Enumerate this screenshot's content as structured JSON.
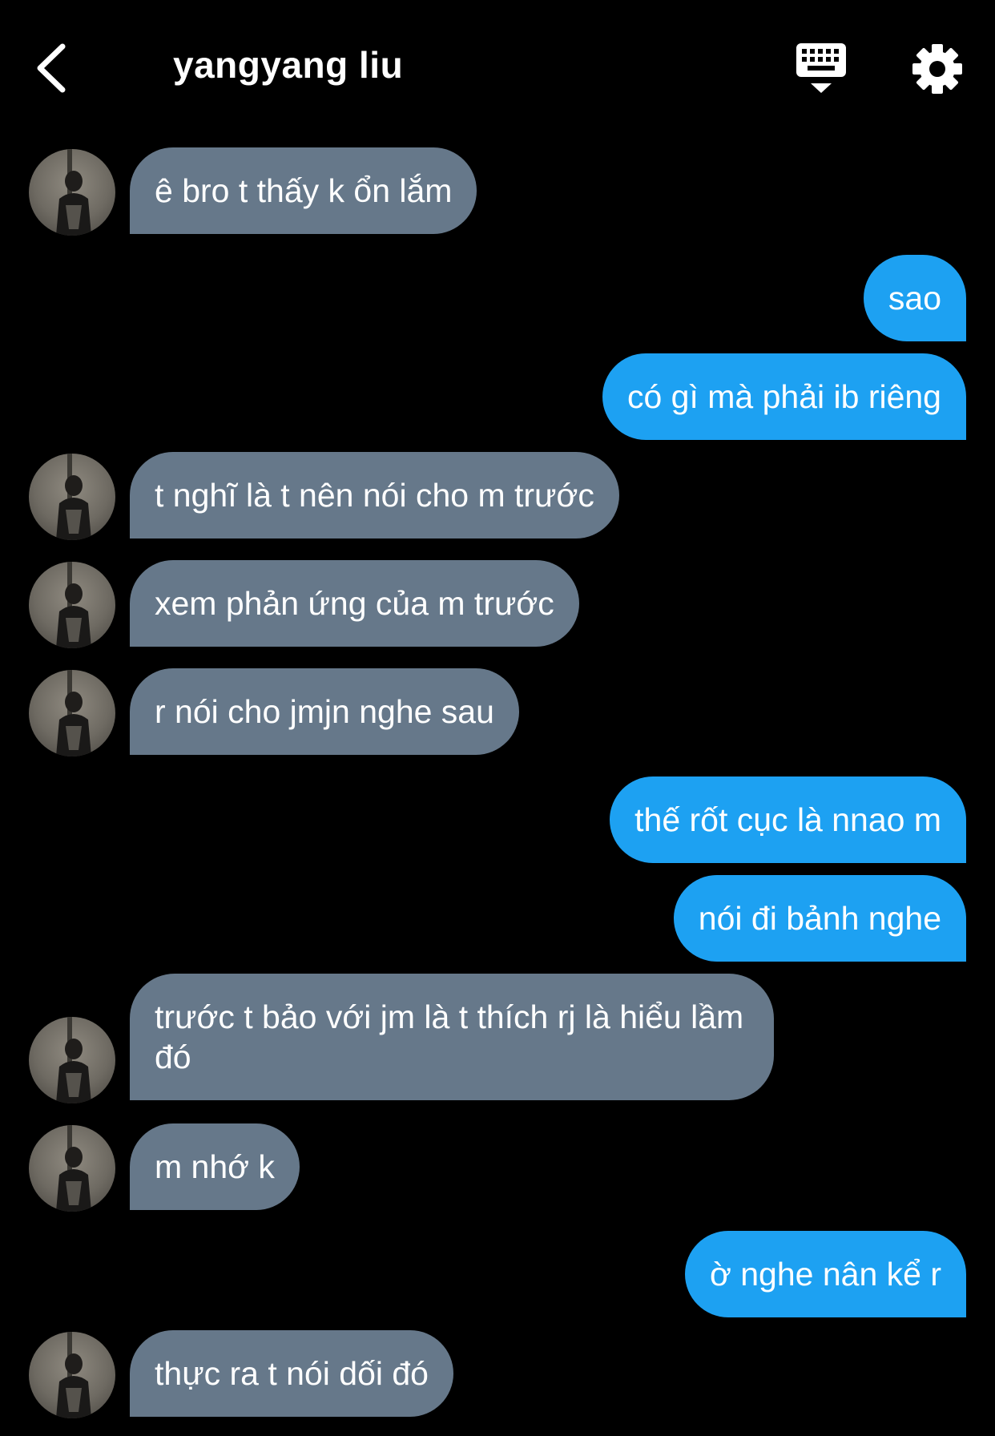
{
  "header": {
    "title": "yangyang liu",
    "back_icon": "chevron-left-icon",
    "keyboard_icon": "keyboard-icon",
    "settings_icon": "gear-icon"
  },
  "colors": {
    "background": "#000000",
    "incoming_bubble": "#66788a",
    "outgoing_bubble": "#1da1f2",
    "text": "#ffffff"
  },
  "messages": [
    {
      "direction": "in",
      "text": "ê bro t thấy k ổn lắm"
    },
    {
      "direction": "out",
      "text": "sao"
    },
    {
      "direction": "out",
      "text": "có gì mà phải ib riêng"
    },
    {
      "direction": "in",
      "text": "t nghĩ là t nên nói cho m trước"
    },
    {
      "direction": "in",
      "text": "xem phản ứng của m trước"
    },
    {
      "direction": "in",
      "text": "r nói cho jmjn nghe sau"
    },
    {
      "direction": "out",
      "text": "thế rốt cục là nnao m"
    },
    {
      "direction": "out",
      "text": "nói đi bảnh nghe"
    },
    {
      "direction": "in",
      "text": "trước t bảo với jm là t thích rj là hiểu lầm đó"
    },
    {
      "direction": "in",
      "text": "m nhớ k"
    },
    {
      "direction": "out",
      "text": "ờ nghe nân kể r"
    },
    {
      "direction": "in",
      "text": "thực ra t nói dối đó"
    }
  ]
}
